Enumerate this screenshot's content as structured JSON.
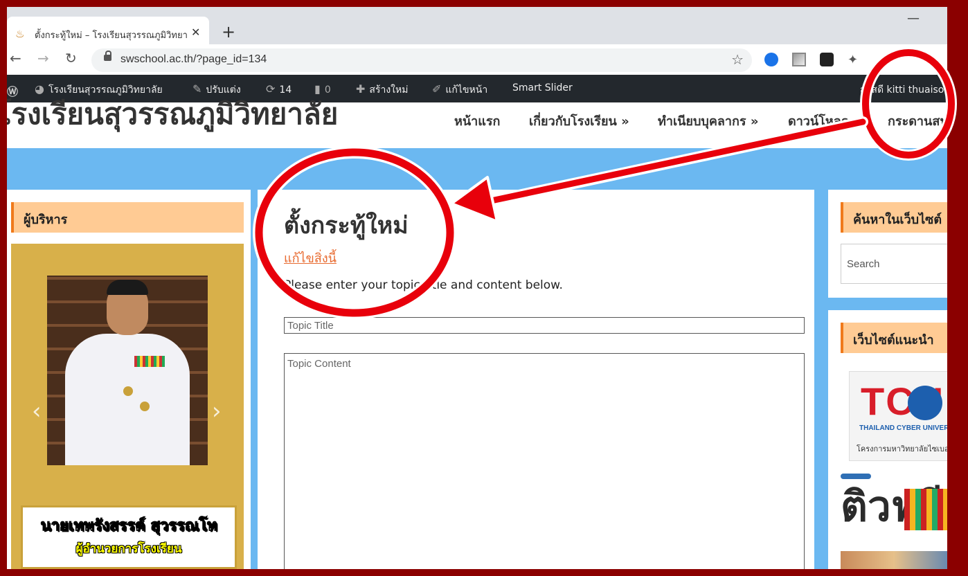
{
  "browser": {
    "tab_title": "ตั้งกระทู้ใหม่ – โรงเรียนสุวรรณภูมิวิทยาลัย",
    "tab_close": "✕",
    "new_tab": "+",
    "minimize": "—",
    "url": "swschool.ac.th/?page_id=134",
    "back": "←",
    "forward": "→",
    "reload": "↻",
    "star": "☆"
  },
  "admin_bar": {
    "site_name": "โรงเรียนสุวรรณภูมิวิทยาลัย",
    "customize": "ปรับแต่ง",
    "updates_count": "14",
    "comments_count": "0",
    "new": "สร้างใหม่",
    "edit_page": "แก้ไขหน้า",
    "smart_slider": "Smart Slider",
    "greeting": "สวัสดี kitti thuaison"
  },
  "site": {
    "title": "โรงเรียนสุวรรณภูมิวิทยาลัย",
    "menu": [
      "หน้าแรก",
      "เกี่ยวกับโรงเรียน »",
      "ทำเนียบบุคลากร »",
      "ดาวน์โหลด »",
      "กระดานสนทนา"
    ]
  },
  "left_sidebar": {
    "widget_title": "ผู้บริหาร",
    "prev": "‹",
    "next": "›",
    "caption_name": "นายเทพรังสรรค์ สุวรรณโท",
    "caption_role": "ผู้อำนวยการโรงเรียน"
  },
  "main": {
    "page_title": "ตั้งกระทู้ใหม่",
    "edit_link": "แก้ไขสิ่งนี้",
    "instructions": "Please enter your topic title and content below.",
    "topic_title_placeholder": "Topic Title",
    "topic_content_placeholder": "Topic Content"
  },
  "right_sidebar": {
    "search_title": "ค้นหาในเว็บไซต์",
    "search_placeholder": "Search",
    "recommended_title": "เว็บไซต์แนะนำ",
    "tcu_logo": "TCU",
    "tcu_sub": "THAILAND CYBER UNIVERSITY",
    "tcu_caption": "โครงการมหาวิทยาลัยไซเบอร์ไทย",
    "tua_logo": "ติวฟรี"
  },
  "colors": {
    "frame": "#8b0000",
    "admin_bar": "#23282d",
    "content_bg": "#6bb8f1",
    "widget_title_bg": "#ffcb94",
    "annotation": "#e8000b",
    "edit_link": "#e86a2f"
  }
}
